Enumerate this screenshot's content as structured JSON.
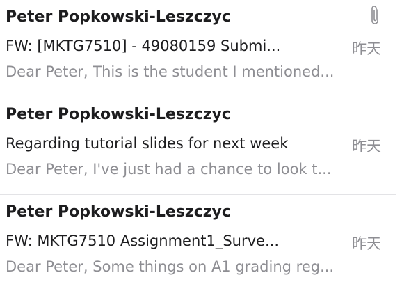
{
  "colors": {
    "primary_text": "#1d1d1f",
    "secondary_text": "#8e8e93",
    "divider": "#e3e3e6",
    "background": "#ffffff"
  },
  "messages": [
    {
      "sender": "Peter Popkowski-Leszczyc",
      "subject": "FW: [MKTG7510] - 49080159 Submi...",
      "date": "昨天",
      "preview": "Dear Peter, This is the student I mentioned...",
      "has_attachment": true,
      "attachment_icon": "paperclip-icon"
    },
    {
      "sender": "Peter Popkowski-Leszczyc",
      "subject": "Regarding tutorial slides for next week",
      "date": "昨天",
      "preview": "Dear Peter, I've just had a chance to look t...",
      "has_attachment": false
    },
    {
      "sender": "Peter Popkowski-Leszczyc",
      "subject": "FW: MKTG7510 Assignment1_Surve...",
      "date": "昨天",
      "preview": "Dear Peter, Some things on A1 grading reg...",
      "has_attachment": false
    }
  ]
}
